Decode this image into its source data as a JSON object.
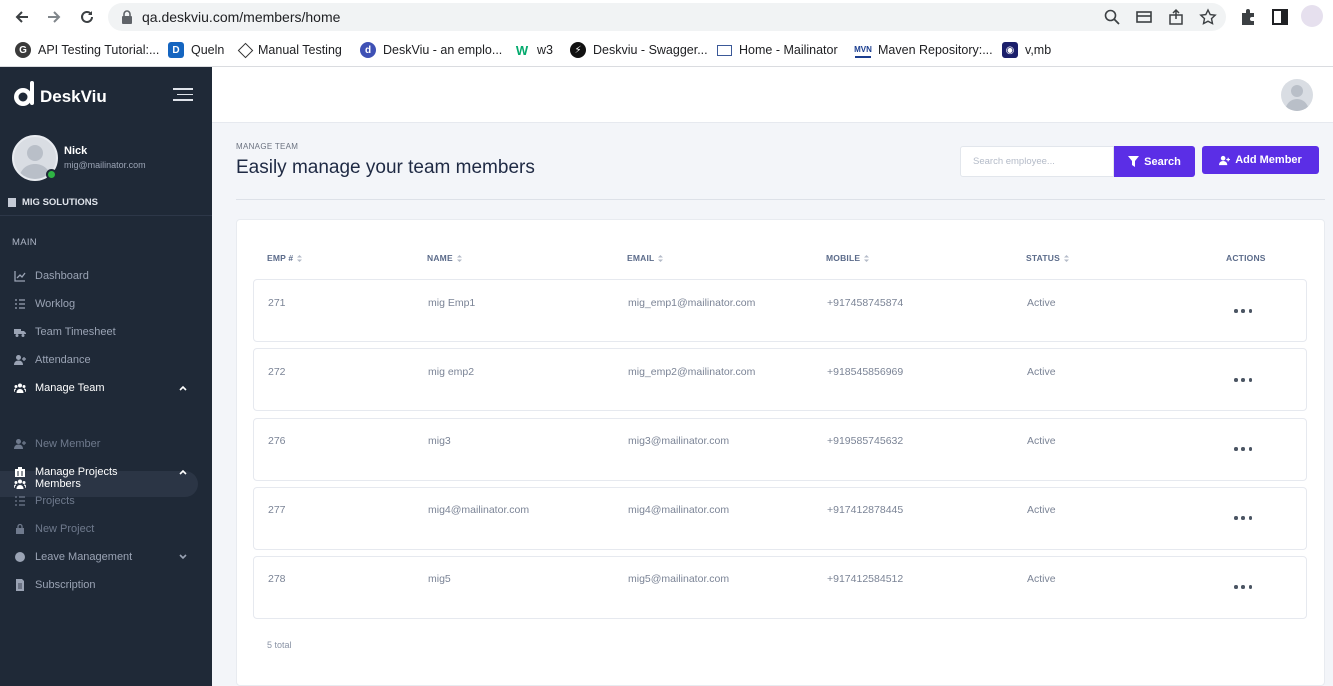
{
  "browser": {
    "url": "qa.deskviu.com/members/home",
    "bookmarks": [
      {
        "label": "API Testing Tutorial:...",
        "icon": "api-favicon"
      },
      {
        "label": "Queln",
        "icon": "queln-favicon"
      },
      {
        "label": "Manual Testing",
        "icon": "manual-favicon"
      },
      {
        "label": "DeskViu - an emplo...",
        "icon": "deskviu-favicon"
      },
      {
        "label": "w3",
        "icon": "w3-favicon"
      },
      {
        "label": "Deskviu - Swagger...",
        "icon": "swagger-favicon"
      },
      {
        "label": "Home - Mailinator",
        "icon": "mailinator-favicon"
      },
      {
        "label": "Maven Repository:...",
        "icon": "maven-favicon"
      },
      {
        "label": "v,mb",
        "icon": "vmb-favicon"
      }
    ]
  },
  "sidebar": {
    "brand": "DeskViu",
    "user": {
      "name": "Nick",
      "email": "mig@mailinator.com"
    },
    "org": "MIG SOLUTIONS",
    "section": "MAIN",
    "items": [
      {
        "label": "Dashboard",
        "icon": "chart-icon"
      },
      {
        "label": "Worklog",
        "icon": "list-icon"
      },
      {
        "label": "Team Timesheet",
        "icon": "truck-icon"
      },
      {
        "label": "Attendance",
        "icon": "user-plus-icon"
      },
      {
        "label": "Manage Team",
        "icon": "users-icon"
      },
      {
        "label": "Members",
        "icon": "users-icon"
      },
      {
        "label": "New Member",
        "icon": "user-plus-icon"
      },
      {
        "label": "Manage Projects",
        "icon": "projects-icon"
      },
      {
        "label": "Projects",
        "icon": "list-icon"
      },
      {
        "label": "New Project",
        "icon": "lock-icon"
      },
      {
        "label": "Leave Management",
        "icon": "circle-icon"
      },
      {
        "label": "Subscription",
        "icon": "file-icon"
      }
    ]
  },
  "main": {
    "breadcrumb": "MANAGE TEAM",
    "title": "Easily manage your team members",
    "search_placeholder": "Search employee...",
    "search_label": "Search",
    "add_label": "Add Member",
    "columns": [
      "EMP #",
      "NAME",
      "EMAIL",
      "MOBILE",
      "STATUS",
      "ACTIONS"
    ],
    "rows": [
      {
        "emp": "271",
        "name": "mig Emp1",
        "email": "mig_emp1@mailinator.com",
        "mobile": "+917458745874",
        "status": "Active"
      },
      {
        "emp": "272",
        "name": "mig emp2",
        "email": "mig_emp2@mailinator.com",
        "mobile": "+918545856969",
        "status": "Active"
      },
      {
        "emp": "276",
        "name": "mig3",
        "email": "mig3@mailinator.com",
        "mobile": "+919585745632",
        "status": "Active"
      },
      {
        "emp": "277",
        "name": "mig4@mailinator.com",
        "email": "mig4@mailinator.com",
        "mobile": "+917412878445",
        "status": "Active"
      },
      {
        "emp": "278",
        "name": "mig5",
        "email": "mig5@mailinator.com",
        "mobile": "+917412584512",
        "status": "Active"
      }
    ],
    "total": "5 total"
  },
  "colors": {
    "accent": "#5b2ee6",
    "sidebar": "#1f2937",
    "online": "#2fb344"
  }
}
